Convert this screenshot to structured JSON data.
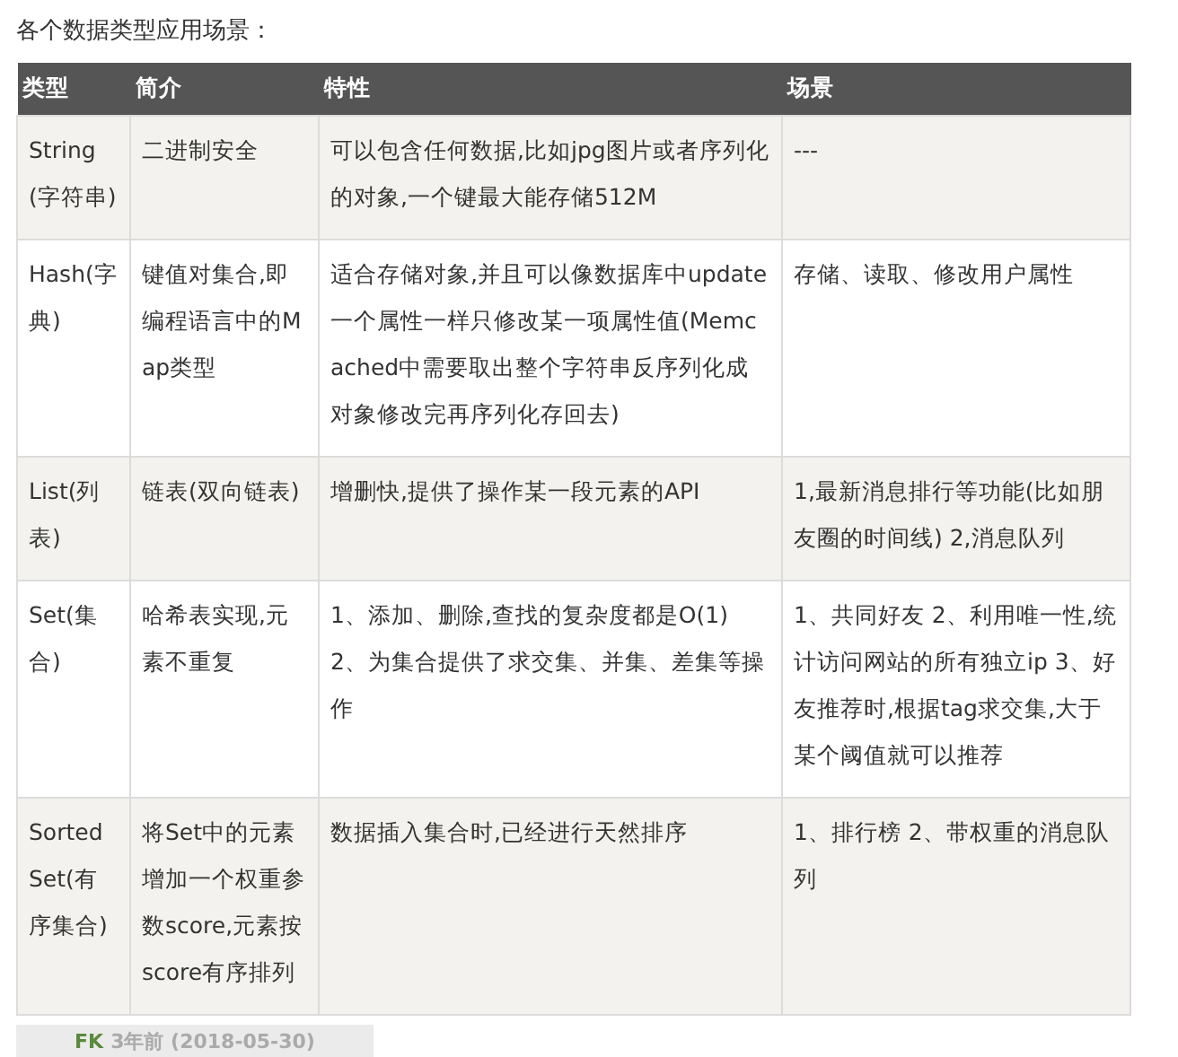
{
  "heading": "各个数据类型应用场景：",
  "table": {
    "columns": [
      "类型",
      "简介",
      "特性",
      "场景"
    ],
    "rows": [
      [
        "String(字符串)",
        "二进制安全",
        "可以包含任何数据,比如jpg图片或者序列化的对象,一个键最大能存储512M",
        "---"
      ],
      [
        "Hash(字典)",
        "键值对集合,即编程语言中的Map类型",
        "适合存储对象,并且可以像数据库中update一个属性一样只修改某一项属性值(Memcached中需要取出整个字符串反序列化成对象修改完再序列化存回去)",
        "存储、读取、修改用户属性"
      ],
      [
        "List(列表)",
        "链表(双向链表)",
        "增删快,提供了操作某一段元素的API",
        "1,最新消息排行等功能(比如朋友圈的时间线) 2,消息队列"
      ],
      [
        "Set(集合)",
        "哈希表实现,元素不重复",
        "1、添加、删除,查找的复杂度都是O(1) 2、为集合提供了求交集、并集、差集等操作",
        "1、共同好友 2、利用唯一性,统计访问网站的所有独立ip 3、好友推荐时,根据tag求交集,大于某个阈值就可以推荐"
      ],
      [
        "Sorted Set(有序集合)",
        "将Set中的元素增加一个权重参数score,元素按score有序排列",
        "数据插入集合时,已经进行天然排序",
        "1、排行榜 2、带权重的消息队列"
      ]
    ]
  },
  "footer": {
    "author": "FK",
    "time": "3年前 (2018-05-30)"
  }
}
